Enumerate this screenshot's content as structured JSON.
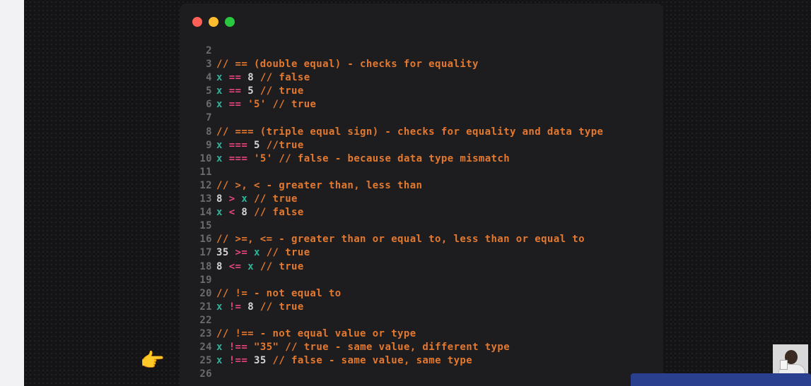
{
  "window_controls": [
    "close",
    "minimize",
    "maximize"
  ],
  "colors": {
    "comment": "#e3782f",
    "variable": "#2fb39a",
    "operator": "#e6457a",
    "number": "#d4d4d4",
    "string": "#e3782f",
    "line_number": "#6b6b6b",
    "editor_bg": "#1d1d20"
  },
  "pointer_icon": "pointing-hand-icon",
  "code_lines": [
    {
      "num": "2",
      "tokens": []
    },
    {
      "num": "3",
      "tokens": [
        {
          "t": "c",
          "v": "// == (double equal) - checks for equality"
        }
      ]
    },
    {
      "num": "4",
      "tokens": [
        {
          "t": "v",
          "v": "x"
        },
        {
          "t": "t",
          "v": " "
        },
        {
          "t": "o",
          "v": "=="
        },
        {
          "t": "t",
          "v": " "
        },
        {
          "t": "n",
          "v": "8"
        },
        {
          "t": "t",
          "v": " "
        },
        {
          "t": "c",
          "v": "// false"
        }
      ]
    },
    {
      "num": "5",
      "tokens": [
        {
          "t": "v",
          "v": "x"
        },
        {
          "t": "t",
          "v": " "
        },
        {
          "t": "o",
          "v": "=="
        },
        {
          "t": "t",
          "v": " "
        },
        {
          "t": "n",
          "v": "5"
        },
        {
          "t": "t",
          "v": " "
        },
        {
          "t": "c",
          "v": "// true"
        }
      ]
    },
    {
      "num": "6",
      "tokens": [
        {
          "t": "v",
          "v": "x"
        },
        {
          "t": "t",
          "v": " "
        },
        {
          "t": "o",
          "v": "=="
        },
        {
          "t": "t",
          "v": " "
        },
        {
          "t": "s",
          "v": "'5'"
        },
        {
          "t": "t",
          "v": " "
        },
        {
          "t": "c",
          "v": "// true"
        }
      ]
    },
    {
      "num": "7",
      "tokens": []
    },
    {
      "num": "8",
      "tokens": [
        {
          "t": "c",
          "v": "// === (triple equal sign) - checks for equality and data type"
        }
      ]
    },
    {
      "num": "9",
      "tokens": [
        {
          "t": "v",
          "v": "x"
        },
        {
          "t": "t",
          "v": " "
        },
        {
          "t": "o",
          "v": "==="
        },
        {
          "t": "t",
          "v": " "
        },
        {
          "t": "n",
          "v": "5"
        },
        {
          "t": "t",
          "v": " "
        },
        {
          "t": "c",
          "v": "//true"
        }
      ]
    },
    {
      "num": "10",
      "tokens": [
        {
          "t": "v",
          "v": "x"
        },
        {
          "t": "t",
          "v": " "
        },
        {
          "t": "o",
          "v": "==="
        },
        {
          "t": "t",
          "v": " "
        },
        {
          "t": "s",
          "v": "'5'"
        },
        {
          "t": "t",
          "v": " "
        },
        {
          "t": "c",
          "v": "// false - because data type mismatch"
        }
      ]
    },
    {
      "num": "11",
      "tokens": []
    },
    {
      "num": "12",
      "tokens": [
        {
          "t": "c",
          "v": "// >, < - greater than, less than"
        }
      ]
    },
    {
      "num": "13",
      "tokens": [
        {
          "t": "n",
          "v": "8"
        },
        {
          "t": "t",
          "v": " "
        },
        {
          "t": "o",
          "v": ">"
        },
        {
          "t": "t",
          "v": " "
        },
        {
          "t": "v",
          "v": "x"
        },
        {
          "t": "t",
          "v": " "
        },
        {
          "t": "c",
          "v": "// true"
        }
      ]
    },
    {
      "num": "14",
      "tokens": [
        {
          "t": "v",
          "v": "x"
        },
        {
          "t": "t",
          "v": " "
        },
        {
          "t": "o",
          "v": "<"
        },
        {
          "t": "t",
          "v": " "
        },
        {
          "t": "n",
          "v": "8"
        },
        {
          "t": "t",
          "v": " "
        },
        {
          "t": "c",
          "v": "// false"
        }
      ]
    },
    {
      "num": "15",
      "tokens": []
    },
    {
      "num": "16",
      "tokens": [
        {
          "t": "c",
          "v": "// >=, <= - greater than or equal to, less than or equal to"
        }
      ]
    },
    {
      "num": "17",
      "tokens": [
        {
          "t": "n",
          "v": "35"
        },
        {
          "t": "t",
          "v": " "
        },
        {
          "t": "o",
          "v": ">="
        },
        {
          "t": "t",
          "v": " "
        },
        {
          "t": "v",
          "v": "x"
        },
        {
          "t": "t",
          "v": " "
        },
        {
          "t": "c",
          "v": "// true"
        }
      ]
    },
    {
      "num": "18",
      "tokens": [
        {
          "t": "n",
          "v": "8"
        },
        {
          "t": "t",
          "v": " "
        },
        {
          "t": "o",
          "v": "<="
        },
        {
          "t": "t",
          "v": " "
        },
        {
          "t": "v",
          "v": "x"
        },
        {
          "t": "t",
          "v": " "
        },
        {
          "t": "c",
          "v": "// true"
        }
      ]
    },
    {
      "num": "19",
      "tokens": []
    },
    {
      "num": "20",
      "tokens": [
        {
          "t": "c",
          "v": "// != - not equal to"
        }
      ]
    },
    {
      "num": "21",
      "tokens": [
        {
          "t": "v",
          "v": "x"
        },
        {
          "t": "t",
          "v": " "
        },
        {
          "t": "o",
          "v": "!="
        },
        {
          "t": "t",
          "v": " "
        },
        {
          "t": "n",
          "v": "8"
        },
        {
          "t": "t",
          "v": " "
        },
        {
          "t": "c",
          "v": "// true"
        }
      ]
    },
    {
      "num": "22",
      "tokens": []
    },
    {
      "num": "23",
      "tokens": [
        {
          "t": "c",
          "v": "// !== - not equal value or type"
        }
      ]
    },
    {
      "num": "24",
      "tokens": [
        {
          "t": "v",
          "v": "x"
        },
        {
          "t": "t",
          "v": " "
        },
        {
          "t": "o",
          "v": "!=="
        },
        {
          "t": "t",
          "v": " "
        },
        {
          "t": "s",
          "v": "\"35\""
        },
        {
          "t": "t",
          "v": " "
        },
        {
          "t": "c",
          "v": "// true - same value, different type"
        }
      ]
    },
    {
      "num": "25",
      "tokens": [
        {
          "t": "v",
          "v": "x"
        },
        {
          "t": "t",
          "v": " "
        },
        {
          "t": "o",
          "v": "!=="
        },
        {
          "t": "t",
          "v": " "
        },
        {
          "t": "n",
          "v": "35"
        },
        {
          "t": "t",
          "v": " "
        },
        {
          "t": "c",
          "v": "// false - same value, same type"
        }
      ]
    },
    {
      "num": "26",
      "tokens": []
    }
  ]
}
